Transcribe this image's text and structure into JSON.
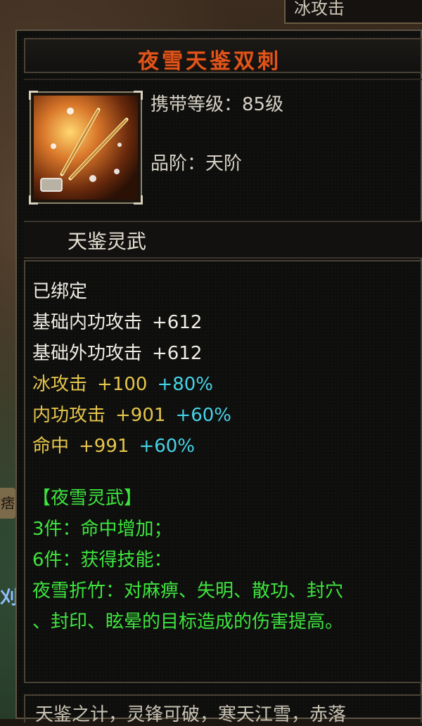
{
  "background": {
    "tab_label": "冰攻击",
    "edge_mark": "痞",
    "left_label": "刈"
  },
  "tooltip": {
    "title": "夜雪天鉴双刺",
    "level_label": "携带等级：85级",
    "grade_label": "品阶：天阶",
    "item_icon": "twin-daggers-icon",
    "set_series": "天鉴灵武",
    "bind_status": "已绑定",
    "stats": [
      {
        "name": "基础内功攻击",
        "value": "+612",
        "bonus": ""
      },
      {
        "name": "基础外功攻击",
        "value": "+612",
        "bonus": ""
      },
      {
        "name": "冰攻击",
        "value": "+100",
        "bonus": "+80%"
      },
      {
        "name": "内功攻击",
        "value": "+901",
        "bonus": "+60%"
      },
      {
        "name": "命中",
        "value": "+991",
        "bonus": "+60%"
      }
    ],
    "set": {
      "name": "【夜雪灵武】",
      "bonus_3": "3件：命中增加；",
      "bonus_6": "6件：获得技能：",
      "skill_line1": "夜雪折竹：对麻痹、失明、散功、封穴",
      "skill_line2": "、封印、眩晕的目标造成的伤害提高。"
    },
    "footer_partial": "天鉴之计，灵锋可破，寒天江雪，赤落"
  },
  "colors": {
    "title": "#e0551b",
    "base_stat": "#f1ede4",
    "element_stat": "#e6c64c",
    "percent_bonus": "#46d3e6",
    "set_text": "#3ee53e"
  }
}
